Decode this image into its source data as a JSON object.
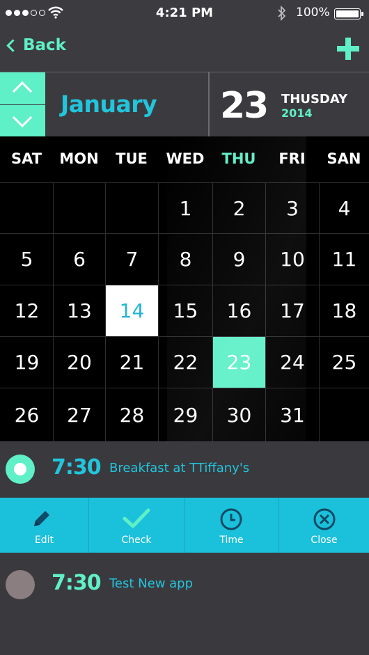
{
  "status_bar": {
    "time": "4:21 PM",
    "battery": "100%"
  },
  "nav": {
    "back_label": "Back"
  },
  "header": {
    "month": "January",
    "day": "23",
    "weekday": "THUSDAY",
    "year": "2014"
  },
  "calendar": {
    "weekdays": [
      "SAT",
      "MON",
      "TUE",
      "WED",
      "THU",
      "FRI",
      "SAN"
    ],
    "active_weekday": "THU",
    "rows": [
      [
        "",
        "",
        "",
        "1",
        "2",
        "3",
        "4"
      ],
      [
        "5",
        "6",
        "7",
        "8",
        "9",
        "10",
        "11"
      ],
      [
        "12",
        "13",
        "14",
        "15",
        "16",
        "17",
        "18"
      ],
      [
        "19",
        "20",
        "21",
        "22",
        "23",
        "24",
        "25"
      ],
      [
        "26",
        "27",
        "28",
        "29",
        "30",
        "31",
        ""
      ]
    ],
    "selected_day": "14",
    "today": "23"
  },
  "events": [
    {
      "time": "7:30",
      "title": "Breakfast at TTiffany's"
    },
    {
      "time": "7:30",
      "title": "Test New app"
    }
  ],
  "actions": {
    "edit": "Edit",
    "check": "Check",
    "time": "Time",
    "close": "Close"
  },
  "colors": {
    "accent": "#5ff0c8",
    "blue": "#22c5dc",
    "action_bar": "#1bc0da"
  }
}
